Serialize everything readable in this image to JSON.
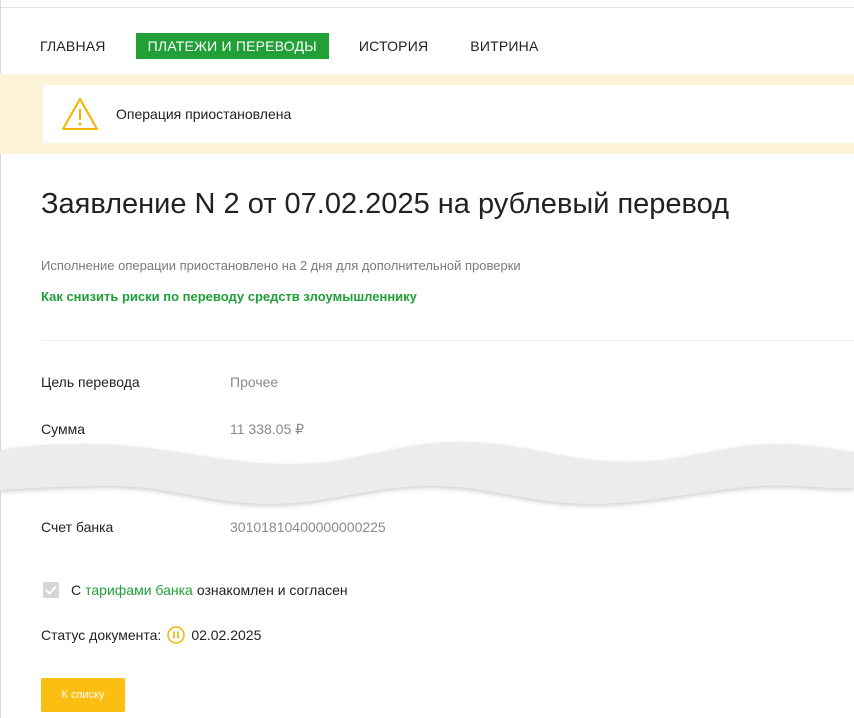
{
  "nav": {
    "items": [
      {
        "label": "ГЛАВНАЯ"
      },
      {
        "label": "ПЛАТЕЖИ И ПЕРЕВОДЫ"
      },
      {
        "label": "ИСТОРИЯ"
      },
      {
        "label": "ВИТРИНА"
      }
    ],
    "active_index": 1
  },
  "alert": {
    "icon": "warning-icon",
    "text": "Операция приостановлена"
  },
  "main": {
    "title": "Заявление N 2 от 07.02.2025 на рублевый перевод",
    "subtitle": "Исполнение операции приостановлено на 2 дня для дополнительной проверки",
    "risk_link": "Как снизить риски по переводу средств злоумышленнику"
  },
  "details": {
    "purpose_label": "Цель перевода",
    "purpose_value": "Прочее",
    "amount_label": "Сумма",
    "amount_value": "11 338.05 ₽",
    "bank_account_label": "Счет банка",
    "bank_account_value": "30101810400000000225"
  },
  "agreement": {
    "prefix": "С",
    "link": "тарифами банка",
    "suffix": "ознакомлен и согласен",
    "checked": true
  },
  "status": {
    "label": "Статус документа:",
    "icon": "pause-icon",
    "date": "02.02.2025"
  },
  "buttons": {
    "back_label": "К списку"
  },
  "colors": {
    "accent": "#21a038",
    "warning": "#fcbe13",
    "alert_bg": "#fdf3d8"
  }
}
